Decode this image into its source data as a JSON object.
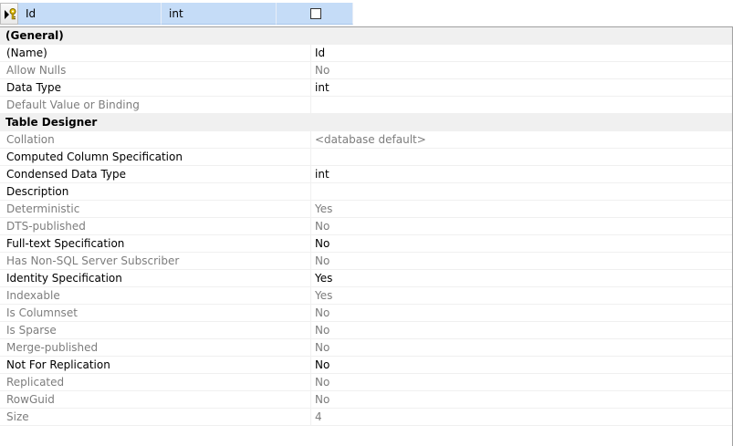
{
  "column_row": {
    "name": "Id",
    "type": "int",
    "allow_nulls_checked": false
  },
  "properties": [
    {
      "kind": "category",
      "label": "(General)"
    },
    {
      "kind": "prop",
      "name": "(Name)",
      "value": "Id",
      "dim": false
    },
    {
      "kind": "prop",
      "name": "Allow Nulls",
      "value": "No",
      "dim": true
    },
    {
      "kind": "prop",
      "name": "Data Type",
      "value": "int",
      "dim": false
    },
    {
      "kind": "prop",
      "name": "Default Value or Binding",
      "value": "",
      "dim": true
    },
    {
      "kind": "category",
      "label": "Table Designer"
    },
    {
      "kind": "prop",
      "name": "Collation",
      "value": "<database default>",
      "dim": true
    },
    {
      "kind": "prop",
      "name": "Computed Column Specification",
      "value": "",
      "dim": false
    },
    {
      "kind": "prop",
      "name": "Condensed Data Type",
      "value": "int",
      "dim": false
    },
    {
      "kind": "prop",
      "name": "Description",
      "value": "",
      "dim": false
    },
    {
      "kind": "prop",
      "name": "Deterministic",
      "value": "Yes",
      "dim": true
    },
    {
      "kind": "prop",
      "name": "DTS-published",
      "value": "No",
      "dim": true
    },
    {
      "kind": "prop",
      "name": "Full-text Specification",
      "value": "No",
      "dim": false
    },
    {
      "kind": "prop",
      "name": "Has Non-SQL Server Subscriber",
      "value": "No",
      "dim": true
    },
    {
      "kind": "prop",
      "name": "Identity Specification",
      "value": "Yes",
      "dim": false
    },
    {
      "kind": "prop",
      "name": "Indexable",
      "value": "Yes",
      "dim": true
    },
    {
      "kind": "prop",
      "name": "Is Columnset",
      "value": "No",
      "dim": true
    },
    {
      "kind": "prop",
      "name": "Is Sparse",
      "value": "No",
      "dim": true
    },
    {
      "kind": "prop",
      "name": "Merge-published",
      "value": "No",
      "dim": true
    },
    {
      "kind": "prop",
      "name": "Not For Replication",
      "value": "No",
      "dim": false
    },
    {
      "kind": "prop",
      "name": "Replicated",
      "value": "No",
      "dim": true
    },
    {
      "kind": "prop",
      "name": "RowGuid",
      "value": "No",
      "dim": true
    },
    {
      "kind": "prop",
      "name": "Size",
      "value": "4",
      "dim": true
    }
  ],
  "colors": {
    "selected_row": "#c5dcf7",
    "category_bg": "#f0f0f0",
    "dim_text": "#7d7d7d"
  }
}
